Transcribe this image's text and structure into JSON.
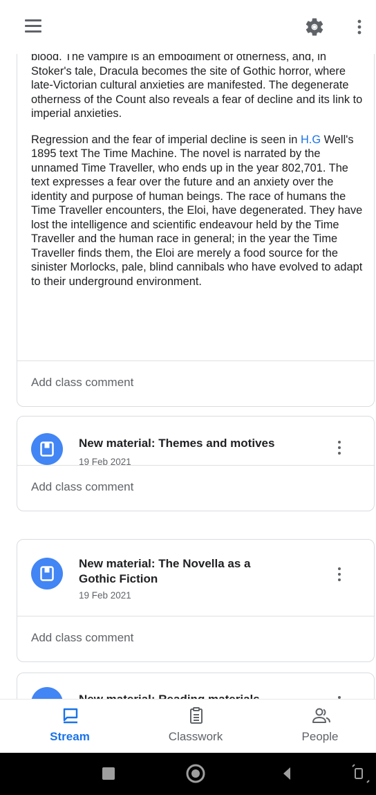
{
  "post": {
    "partial_text": "blood. The vampire is an embodiment of otherness, and, in Stoker's tale, Dracula becomes the site of Gothic horror, where late-Victorian cultural anxieties are manifested. The degenerate otherness of the Count also reveals a fear of decline and its link to imperial anxieties.",
    "para2_before_link": "Regression and the fear of imperial decline is seen in ",
    "para2_link": "H.G",
    "para2_after_link": " Well's 1895 text The Time Machine. The novel is narrated by the unnamed Time Traveller, who ends up in the year 802,701. The text expresses a fear over the future and an anxiety over the identity and purpose of human beings. The race of humans the Time Traveller encounters, the Eloi, have degenerated. They have lost the intelligence and scientific endeavour held by the Time Traveller and the human race in general; in the year the Time Traveller finds them, the Eloi are merely a food source for the sinister Morlocks, pale, blind cannibals who have evolved to adapt to their underground environment.",
    "comment_label": "Add class comment"
  },
  "materials": [
    {
      "title": "New material: Themes and motives",
      "date": "19 Feb 2021",
      "comment_label": "Add class comment"
    },
    {
      "title": "New material: The Novella as a Gothic Fiction",
      "date": "19 Feb 2021",
      "comment_label": "Add class comment"
    },
    {
      "title": "New material: Reading materials"
    }
  ],
  "nav": {
    "stream": "Stream",
    "classwork": "Classwork",
    "people": "People"
  },
  "colors": {
    "accent": "#1a73e8",
    "avatar": "#4285f4",
    "icon_gray": "#5f6368"
  }
}
